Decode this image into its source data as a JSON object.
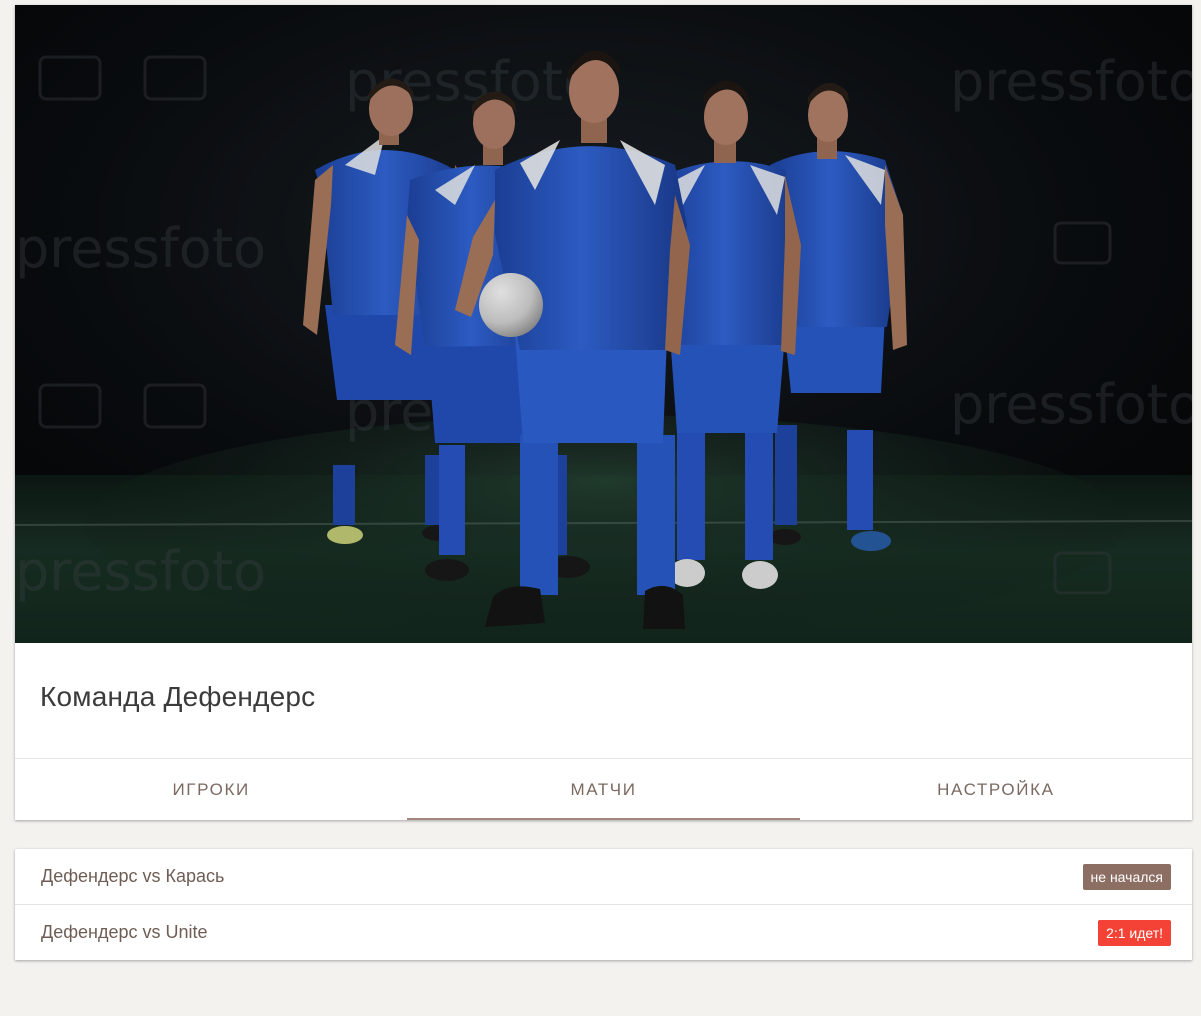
{
  "team": {
    "name": "Команда Дефендерс"
  },
  "tabs": [
    {
      "label": "ИГРОКИ",
      "active": false
    },
    {
      "label": "МАТЧИ",
      "active": true
    },
    {
      "label": "НАСТРОЙКА",
      "active": false
    }
  ],
  "matches": [
    {
      "title": "Дефендерс vs Карась",
      "status": "не начался",
      "status_color": "#8d6e63"
    },
    {
      "title": "Дефендерс vs Unite",
      "status": "2:1  идет!",
      "status_color": "#f44336"
    }
  ],
  "colors": {
    "accent": "#a1887f",
    "tab_text": "#7b6a61",
    "jersey": "#2d5fd0"
  },
  "hero_image": {
    "watermark": "pressfoto"
  }
}
